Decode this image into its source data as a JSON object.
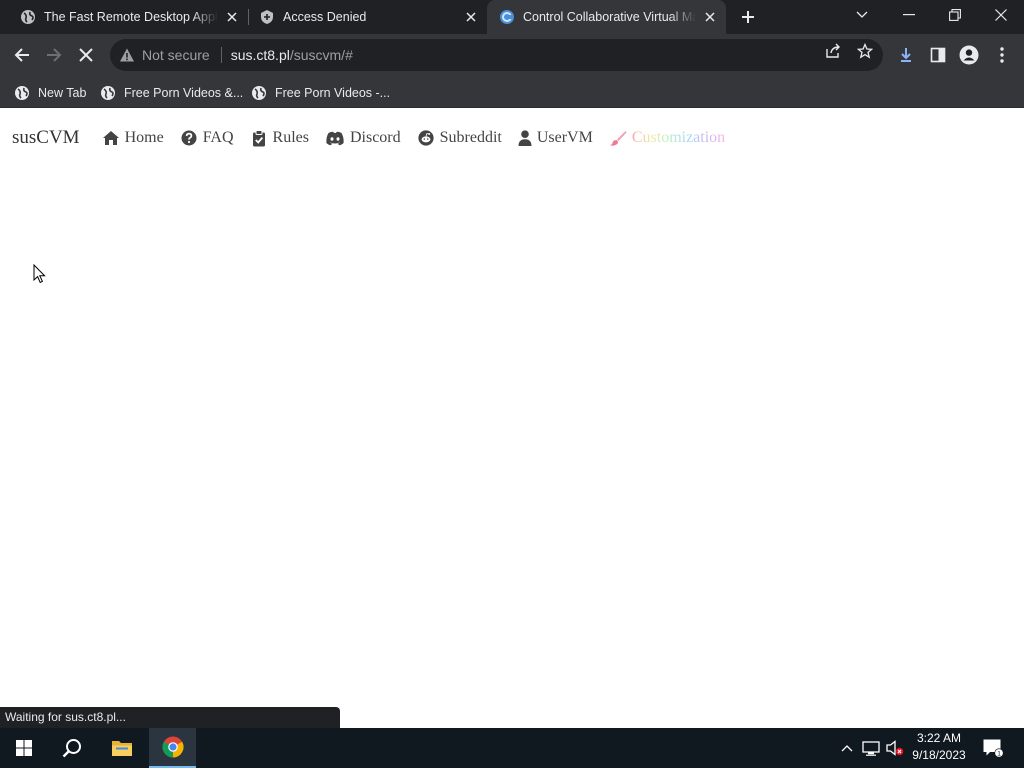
{
  "tabs": [
    {
      "title": "The Fast Remote Desktop Application",
      "icon": "globe-icon",
      "active": false
    },
    {
      "title": "Access Denied",
      "icon": "access-denied-favicon",
      "active": false
    },
    {
      "title": "Control Collaborative Virtual Machines",
      "icon": "cvm-favicon",
      "active": true
    }
  ],
  "toolbar": {
    "security_label": "Not secure",
    "url_host": "sus.ct8.pl",
    "url_path": "/suscvm/#"
  },
  "bookmarks": [
    {
      "label": "New Tab",
      "icon": "globe-icon"
    },
    {
      "label": "Free Porn Videos &...",
      "icon": "globe-icon"
    },
    {
      "label": "Free Porn Videos -...",
      "icon": "globe-icon"
    }
  ],
  "site": {
    "brand": "susCVM",
    "nav": [
      {
        "label": "Home",
        "icon": "home-icon"
      },
      {
        "label": "FAQ",
        "icon": "question-circle-icon"
      },
      {
        "label": "Rules",
        "icon": "clipboard-check-icon"
      },
      {
        "label": "Discord",
        "icon": "discord-icon"
      },
      {
        "label": "Subreddit",
        "icon": "reddit-icon"
      },
      {
        "label": "UserVM",
        "icon": "user-icon"
      },
      {
        "label": "Customization",
        "icon": "paintbrush-icon"
      }
    ]
  },
  "status_bar": "Waiting for sus.ct8.pl...",
  "taskbar": {
    "time": "3:22 AM",
    "date": "9/18/2023",
    "notification_count": "1"
  },
  "colors": {
    "tabstrip": "#202124",
    "toolbar": "#35363a",
    "taskbar": "#101820",
    "page_background": "#ffffff",
    "nav_text": "#444444"
  }
}
